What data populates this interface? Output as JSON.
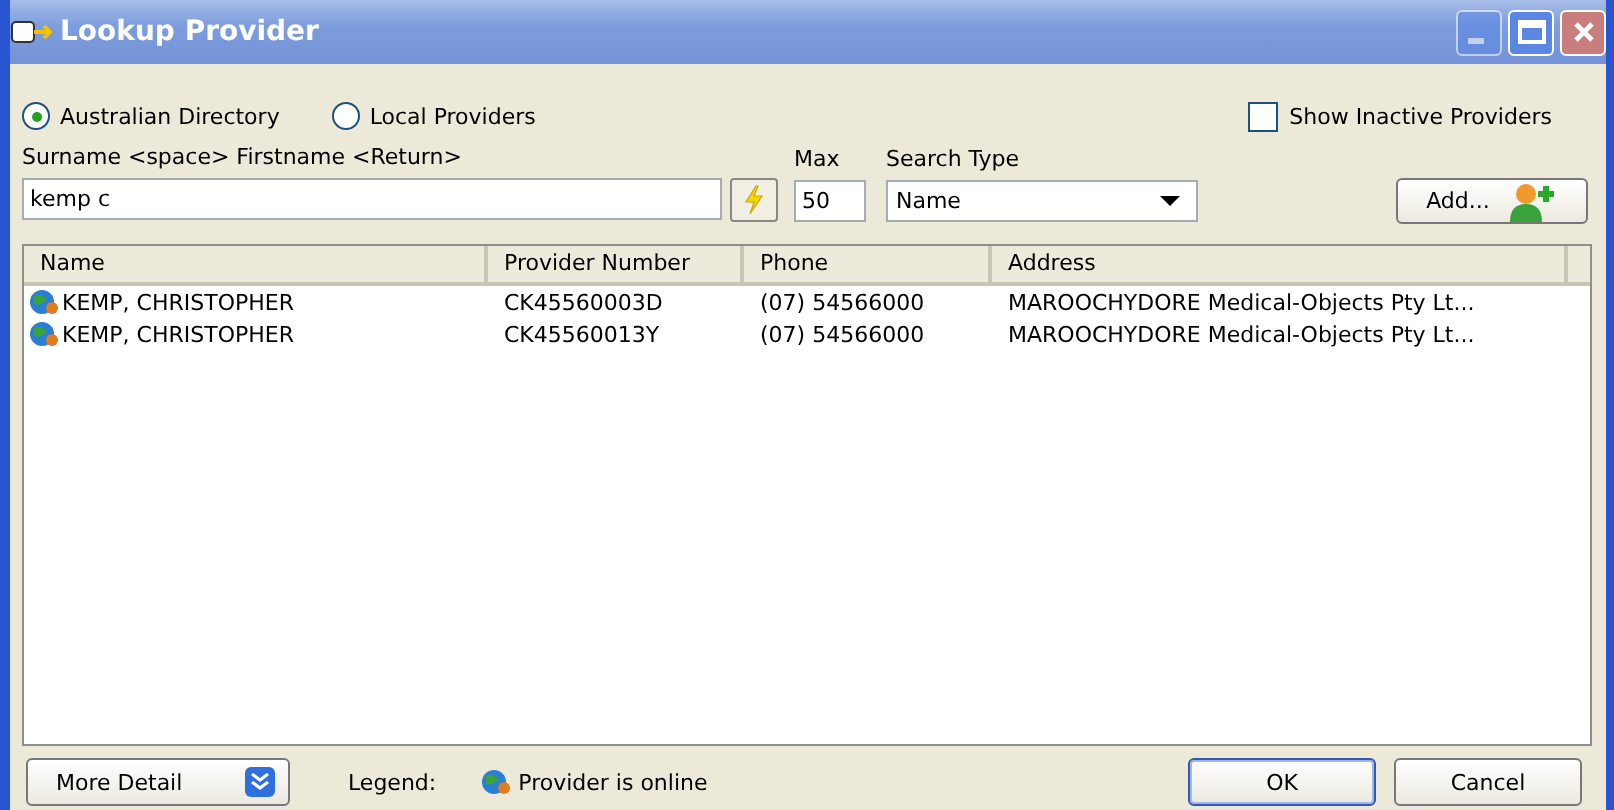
{
  "window": {
    "title": "Lookup Provider"
  },
  "source_options": [
    {
      "label": "Australian Directory",
      "selected": true
    },
    {
      "label": "Local Providers",
      "selected": false
    }
  ],
  "show_inactive": {
    "label": "Show Inactive Providers",
    "checked": false
  },
  "search": {
    "label": "Surname <space> Firstname <Return>",
    "value": "kemp c"
  },
  "max": {
    "label": "Max",
    "value": "50"
  },
  "search_type": {
    "label": "Search Type",
    "value": "Name"
  },
  "add_button": "Add...",
  "table": {
    "columns": [
      "Name",
      "Provider Number",
      "Phone",
      "Address"
    ],
    "rows": [
      {
        "cells": [
          "KEMP, CHRISTOPHER",
          "CK45560003D",
          "(07) 54566000",
          "MAROOCHYDORE Medical-Objects Pty Lt..."
        ],
        "online": true
      },
      {
        "cells": [
          "KEMP, CHRISTOPHER",
          "CK45560013Y",
          "(07) 54566000",
          "MAROOCHYDORE Medical-Objects Pty Lt..."
        ],
        "online": true
      }
    ]
  },
  "more_detail_button": "More Detail",
  "legend": {
    "label": "Legend:",
    "text": "Provider is online"
  },
  "buttons": [
    "OK",
    "Cancel"
  ]
}
